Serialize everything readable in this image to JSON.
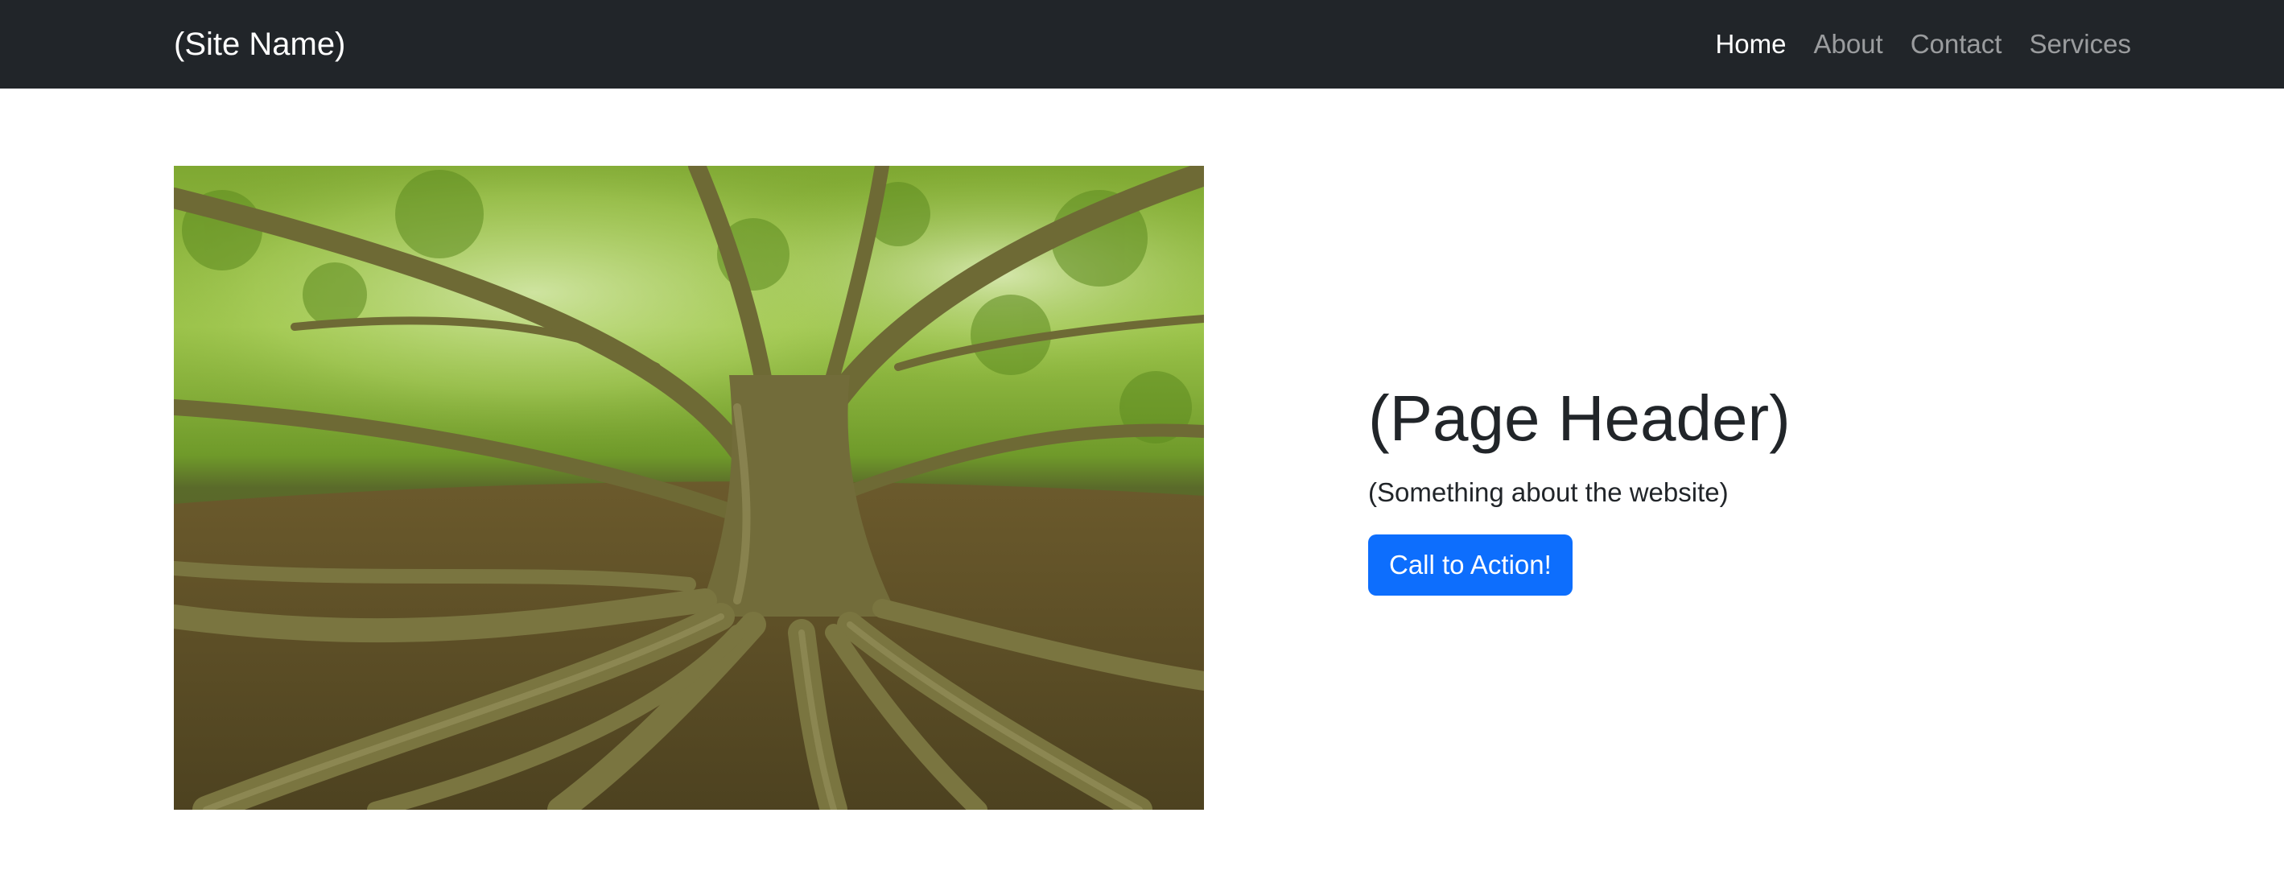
{
  "navbar": {
    "brand": "(Site Name)",
    "links": [
      {
        "label": "Home",
        "active": true
      },
      {
        "label": "About",
        "active": false
      },
      {
        "label": "Contact",
        "active": false
      },
      {
        "label": "Services",
        "active": false
      }
    ],
    "background": "#212529"
  },
  "hero": {
    "image_subject": "tree-with-exposed-roots",
    "header": "(Page Header)",
    "lead": "(Something about the website)",
    "cta_label": "Call to Action!",
    "cta_color": "#0d6efd"
  }
}
